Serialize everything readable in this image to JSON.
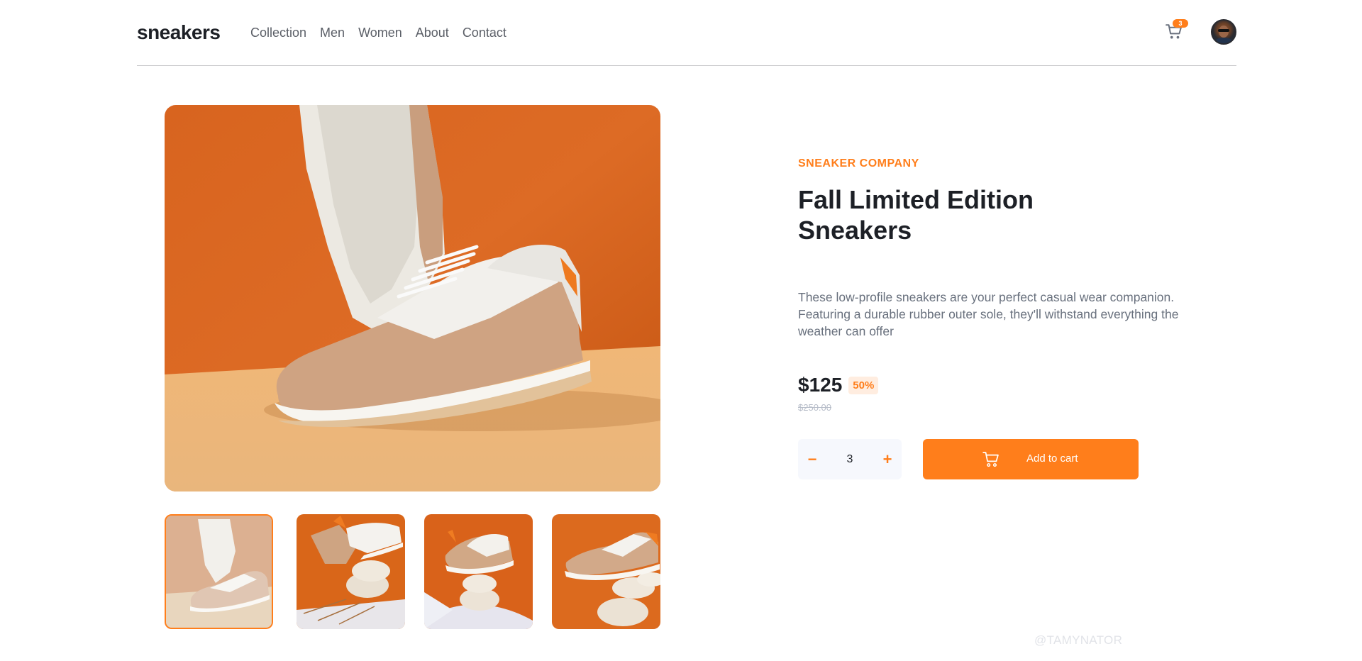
{
  "header": {
    "logo": "sneakers",
    "nav": [
      {
        "label": "Collection"
      },
      {
        "label": "Men"
      },
      {
        "label": "Women"
      },
      {
        "label": "About"
      },
      {
        "label": "Contact"
      }
    ],
    "cart_count": "3",
    "cart_icon": "cart-icon",
    "avatar": "user-avatar"
  },
  "gallery": {
    "thumbnails": [
      "thumbnail-1",
      "thumbnail-2",
      "thumbnail-3",
      "thumbnail-4"
    ],
    "selected_thumbnail": 1
  },
  "product": {
    "company": "SNEAKER COMPANY",
    "title": "Fall Limited Edition Sneakers",
    "description": "These low-profile sneakers are your perfect casual wear companion. Featuring a durable rubber outer sole, they'll withstand everything the weather can offer",
    "price": "$125",
    "discount": "50%",
    "original_price": "$250.00"
  },
  "cart_controls": {
    "minus": "−",
    "plus": "+",
    "quantity": "3",
    "add_to_cart": "Add to cart"
  },
  "watermark": "@TAMYNATOR",
  "colors": {
    "accent": "#ff7e1b",
    "accent_pale": "#ffede0",
    "text_dark": "#1d2026",
    "text_gray": "#68707d"
  }
}
